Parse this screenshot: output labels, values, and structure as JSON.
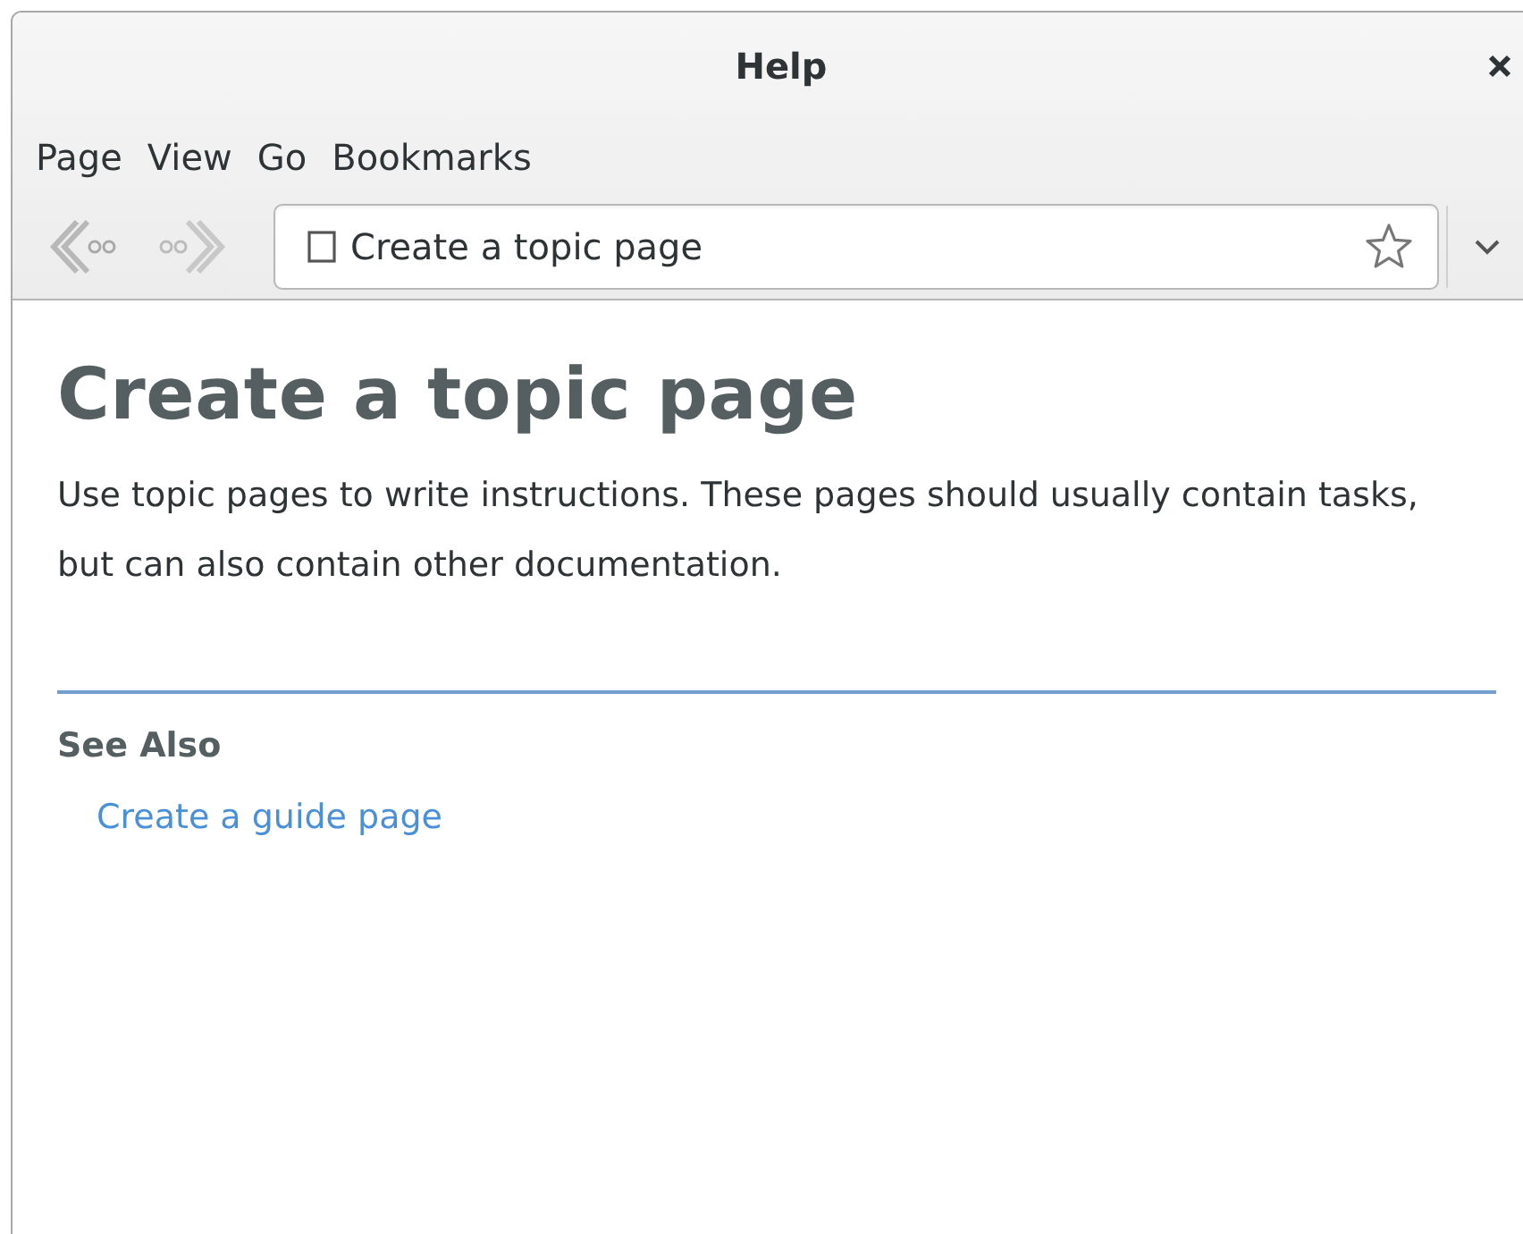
{
  "window": {
    "title": "Help"
  },
  "menu": [
    {
      "label": "Page"
    },
    {
      "label": "View"
    },
    {
      "label": "Go"
    },
    {
      "label": "Bookmarks"
    }
  ],
  "location": {
    "value": "Create a topic page"
  },
  "page": {
    "heading": "Create a topic page",
    "body": "Use topic pages to write instructions. These pages should usually contain tasks, but can also contain other documentation.",
    "see_also": {
      "title": "See Also",
      "links": [
        "Create a guide page"
      ]
    }
  }
}
